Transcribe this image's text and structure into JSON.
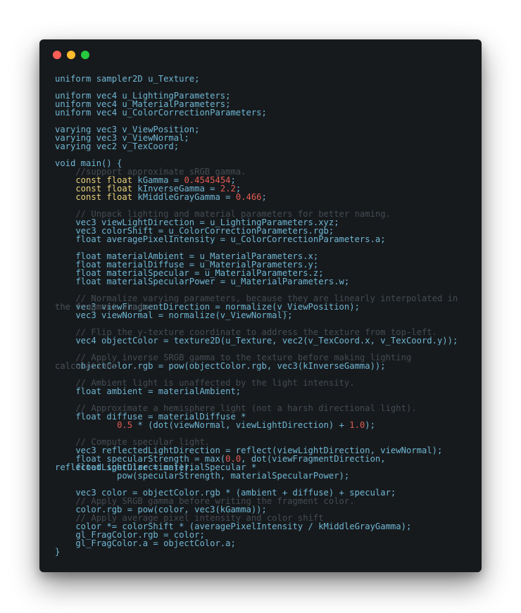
{
  "window": {
    "traffic_lights": {
      "close_color": "#ff5f56",
      "minimize_color": "#ffbd2e",
      "maximize_color": "#27c93f"
    }
  },
  "colors": {
    "background": "#171a1d",
    "identifier": "#6fb7d4",
    "keyword_const": "#e9d27a",
    "number": "#e15a52",
    "comment": "#434b52"
  },
  "lines": [
    [
      [
        "t",
        "uniform sampler2D u_Texture;"
      ]
    ],
    [],
    [
      [
        "t",
        "uniform vec4 u_LightingParameters;"
      ]
    ],
    [
      [
        "t",
        "uniform vec4 u_MaterialParameters;"
      ]
    ],
    [
      [
        "t",
        "uniform vec4 u_ColorCorrectionParameters;"
      ]
    ],
    [],
    [
      [
        "t",
        "varying vec3 v_ViewPosition;"
      ]
    ],
    [
      [
        "t",
        "varying vec3 v_ViewNormal;"
      ]
    ],
    [
      [
        "t",
        "varying vec2 v_TexCoord;"
      ]
    ],
    [],
    [
      [
        "t",
        "void main() {"
      ]
    ],
    [
      [
        "c",
        "    //support approximate sRGB gamma."
      ]
    ],
    [
      [
        "k",
        "    const float "
      ],
      [
        "t",
        "kGamma = "
      ],
      [
        "n",
        "0.4545454"
      ],
      [
        "t",
        ";"
      ]
    ],
    [
      [
        "k",
        "    const float "
      ],
      [
        "t",
        "kInverseGamma = "
      ],
      [
        "n",
        "2.2"
      ],
      [
        "t",
        ";"
      ]
    ],
    [
      [
        "k",
        "    const float "
      ],
      [
        "t",
        "kMiddleGrayGamma = "
      ],
      [
        "n",
        "0.466"
      ],
      [
        "t",
        ";"
      ]
    ],
    [],
    [
      [
        "c",
        "    // Unpack lighting and material parameters for better naming."
      ]
    ],
    [
      [
        "t",
        "    vec3 viewLightDirection = u_LightingParameters.xyz;"
      ]
    ],
    [
      [
        "t",
        "    vec3 colorShift = u_ColorCorrectionParameters.rgb;"
      ]
    ],
    [
      [
        "t",
        "    float averagePixelIntensity = u_ColorCorrectionParameters.a;"
      ]
    ],
    [],
    [
      [
        "t",
        "    float materialAmbient = u_MaterialParameters.x;"
      ]
    ],
    [
      [
        "t",
        "    float materialDiffuse = u_MaterialParameters.y;"
      ]
    ],
    [
      [
        "t",
        "    float materialSpecular = u_MaterialParameters.z;"
      ]
    ],
    [
      [
        "t",
        "    float materialSpecularPower = u_MaterialParameters.w;"
      ]
    ],
    [],
    [
      [
        "c",
        "    // Normalize varying parameters, because they are linearly interpolated in"
      ]
    ],
    [
      [
        "t",
        "    vec3 viewFragmentDirection = normalize(v_ViewPosition);"
      ]
    ],
    [
      [
        "t",
        "    vec3 viewNormal = normalize(v_ViewNormal);"
      ]
    ],
    [],
    [
      [
        "c",
        "    // Flip the y-texture coordinate to address the texture from top-left."
      ]
    ],
    [
      [
        "t",
        "    vec4 objectColor = texture2D(u_Texture, vec2(v_TexCoord.x, v_TexCoord.y));"
      ]
    ],
    [],
    [
      [
        "c",
        "    // Apply inverse SRGB gamma to the texture before making lighting"
      ]
    ],
    [
      [
        "t",
        "    objectColor.rgb = pow(objectColor.rgb, vec3(kInverseGamma));"
      ]
    ],
    [],
    [
      [
        "c",
        "    // Ambient light is unaffected by the light intensity."
      ]
    ],
    [
      [
        "t",
        "    float ambient = materialAmbient;"
      ]
    ],
    [],
    [
      [
        "c",
        "    // Approximate a hemisphere light (not a harsh directional light)."
      ]
    ],
    [
      [
        "t",
        "    float diffuse = materialDiffuse *"
      ]
    ],
    [
      [
        "t",
        "            "
      ],
      [
        "n",
        "0.5"
      ],
      [
        "t",
        " * (dot(viewNormal, viewLightDirection) + "
      ],
      [
        "n",
        "1.0"
      ],
      [
        "t",
        ");"
      ]
    ],
    [],
    [
      [
        "c",
        "    // Compute specular light."
      ]
    ],
    [
      [
        "t",
        "    vec3 reflectedLightDirection = reflect(viewLightDirection, viewNormal);"
      ]
    ],
    [
      [
        "t",
        "    float specularStrength = max("
      ],
      [
        "n",
        "0.0"
      ],
      [
        "t",
        ", dot(viewFragmentDirection,"
      ]
    ],
    [
      [
        "t",
        "    float specular = materialSpecular *"
      ]
    ],
    [
      [
        "t",
        "            pow(specularStrength, materialSpecularPower);"
      ]
    ],
    [],
    [
      [
        "t",
        "    vec3 color = objectColor.rgb * (ambient + diffuse) + specular;"
      ]
    ],
    [
      [
        "c",
        "    // Apply SRGB gamma before writing the fragment color."
      ]
    ],
    [
      [
        "t",
        "    color.rgb = pow(color, vec3(kGamma));"
      ]
    ],
    [
      [
        "c",
        "    // Apply average pixel intensity and color shift"
      ]
    ],
    [
      [
        "t",
        "    color *= colorShift * (averagePixelIntensity / kMiddleGrayGamma);"
      ]
    ],
    [
      [
        "t",
        "    gl_FragColor.rgb = color;"
      ]
    ],
    [
      [
        "t",
        "    gl_FragColor.a = objectColor.a;"
      ]
    ],
    [
      [
        "t",
        "}"
      ]
    ]
  ],
  "wrapped_overlays": [
    {
      "line": 27,
      "text": "the fragment shader.",
      "kind": "comment"
    },
    {
      "line": 34,
      "text": "calculations.",
      "kind": "comment"
    },
    {
      "line": 46,
      "text": "reflectedLightDirection)));",
      "kind": "code"
    }
  ]
}
